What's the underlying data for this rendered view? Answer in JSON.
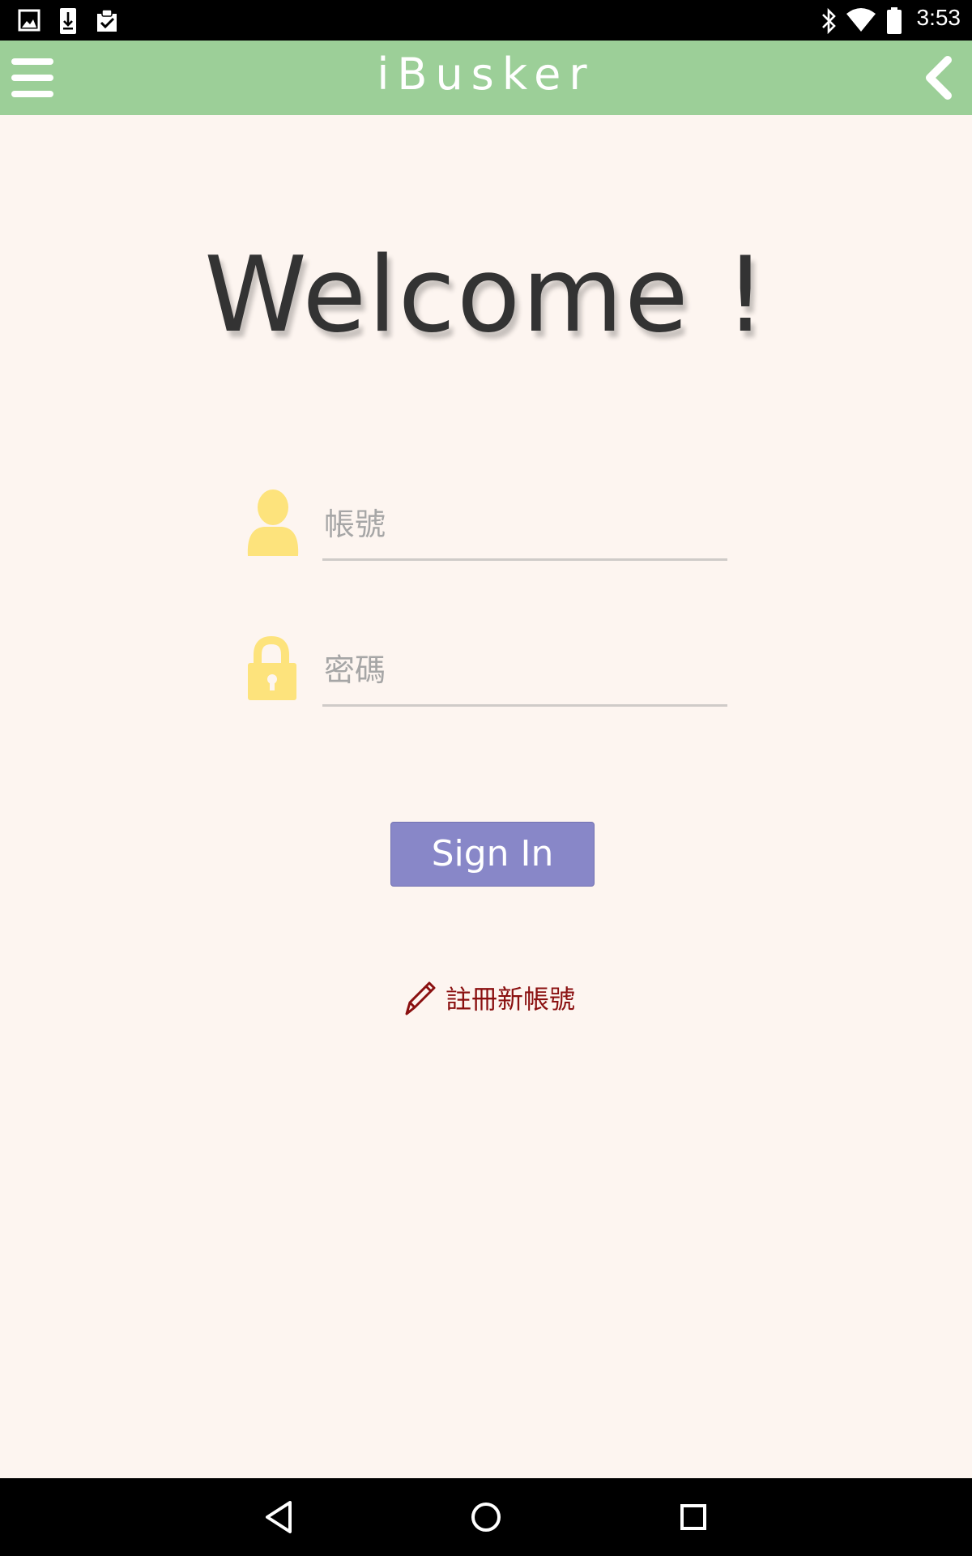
{
  "status_bar": {
    "time": "3:53",
    "left_icons": [
      "image-icon",
      "download-icon",
      "clipboard-check-icon"
    ],
    "right_icons": [
      "bluetooth-icon",
      "wifi-icon",
      "battery-icon"
    ]
  },
  "app_bar": {
    "title": "iBusker",
    "background": "#9ccf98",
    "menu_icon": "hamburger-menu-icon",
    "back_icon": "chevron-left-icon"
  },
  "main": {
    "welcome": "Welcome !",
    "username": {
      "placeholder": "帳號",
      "value": "",
      "icon": "user-icon"
    },
    "password": {
      "placeholder": "密碼",
      "value": "",
      "icon": "lock-icon"
    },
    "sign_in_label": "Sign In",
    "register_label": "註冊新帳號",
    "register_icon": "pencil-icon",
    "colors": {
      "icon_yellow": "#fde37c",
      "button": "#8887c8",
      "register_text": "#8a1010",
      "background": "#fdf5f0"
    }
  },
  "nav_bar": {
    "icons": [
      "back-triangle-icon",
      "home-circle-icon",
      "recents-square-icon"
    ]
  }
}
